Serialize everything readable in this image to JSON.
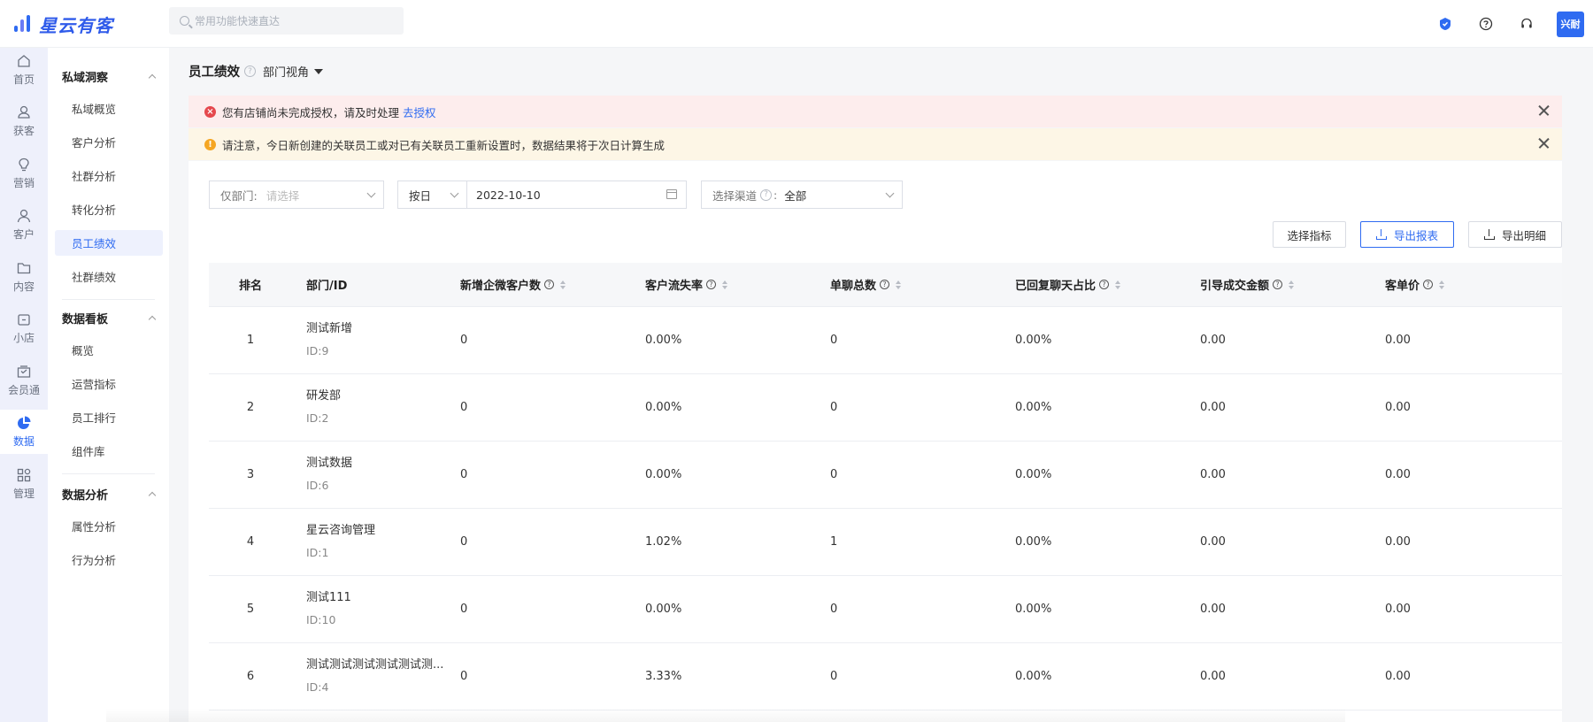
{
  "app": {
    "name": "星云有客"
  },
  "search": {
    "placeholder": "常用功能快速直达"
  },
  "user": {
    "avatar_text": "兴耐"
  },
  "rail": [
    {
      "label": "首页",
      "icon": "home-icon"
    },
    {
      "label": "获客",
      "icon": "user-acquire-icon"
    },
    {
      "label": "营销",
      "icon": "lightbulb-icon"
    },
    {
      "label": "客户",
      "icon": "person-icon"
    },
    {
      "label": "内容",
      "icon": "folder-icon"
    },
    {
      "label": "小店",
      "icon": "shop-icon"
    },
    {
      "label": "会员通",
      "icon": "member-icon"
    },
    {
      "label": "数据",
      "icon": "pie-chart-icon",
      "active": true
    },
    {
      "label": "管理",
      "icon": "grid-icon"
    }
  ],
  "submenu": {
    "groups": [
      {
        "title": "私域洞察",
        "items": [
          "私域概览",
          "客户分析",
          "社群分析",
          "转化分析",
          "员工绩效",
          "社群绩效"
        ]
      },
      {
        "title": "数据看板",
        "items": [
          "概览",
          "运营指标",
          "员工排行",
          "组件库"
        ]
      },
      {
        "title": "数据分析",
        "items": [
          "属性分析",
          "行为分析"
        ]
      }
    ],
    "active": "员工绩效"
  },
  "page": {
    "title": "员工绩效",
    "view": "部门视角"
  },
  "alerts": {
    "error": {
      "text": "您有店铺尚未完成授权，请及时处理",
      "link": "去授权"
    },
    "warn": {
      "text": "请注意，今日新创建的关联员工或对已有关联员工重新设置时，数据结果将于次日计算生成"
    }
  },
  "filters": {
    "dept_label": "仅部门:",
    "dept_placeholder": "请选择",
    "period": "按日",
    "date": "2022-10-10",
    "channel_label": "选择渠道",
    "channel_value": "全部"
  },
  "buttons": {
    "select_metrics": "选择指标",
    "export_report": "导出报表",
    "export_detail": "导出明细"
  },
  "table": {
    "headers": [
      "排名",
      "部门/ID",
      "新增企微客户数",
      "客户流失率",
      "单聊总数",
      "已回复聊天占比",
      "引导成交金额",
      "客单价"
    ],
    "rows": [
      {
        "rank": "1",
        "dept": "测试新增",
        "id": "ID:9",
        "new_customers": "0",
        "churn": "0.00%",
        "chats": "0",
        "reply_ratio": "0.00%",
        "amount": "0.00",
        "unit_price": "0.00"
      },
      {
        "rank": "2",
        "dept": "研发部",
        "id": "ID:2",
        "new_customers": "0",
        "churn": "0.00%",
        "chats": "0",
        "reply_ratio": "0.00%",
        "amount": "0.00",
        "unit_price": "0.00"
      },
      {
        "rank": "3",
        "dept": "测试数据",
        "id": "ID:6",
        "new_customers": "0",
        "churn": "0.00%",
        "chats": "0",
        "reply_ratio": "0.00%",
        "amount": "0.00",
        "unit_price": "0.00"
      },
      {
        "rank": "4",
        "dept": "星云咨询管理",
        "id": "ID:1",
        "new_customers": "0",
        "churn": "1.02%",
        "chats": "1",
        "reply_ratio": "0.00%",
        "amount": "0.00",
        "unit_price": "0.00"
      },
      {
        "rank": "5",
        "dept": "测试111",
        "id": "ID:10",
        "new_customers": "0",
        "churn": "0.00%",
        "chats": "0",
        "reply_ratio": "0.00%",
        "amount": "0.00",
        "unit_price": "0.00"
      },
      {
        "rank": "6",
        "dept": "测试测试测试测试测试测...",
        "id": "ID:4",
        "new_customers": "0",
        "churn": "3.33%",
        "chats": "0",
        "reply_ratio": "0.00%",
        "amount": "0.00",
        "unit_price": "0.00"
      }
    ]
  },
  "colors": {
    "brand": "#2f6bf1",
    "error_bg": "#fdeded",
    "warn_bg": "#fdf6e6",
    "error_icon": "#e5484d",
    "warn_icon": "#f5a623"
  }
}
